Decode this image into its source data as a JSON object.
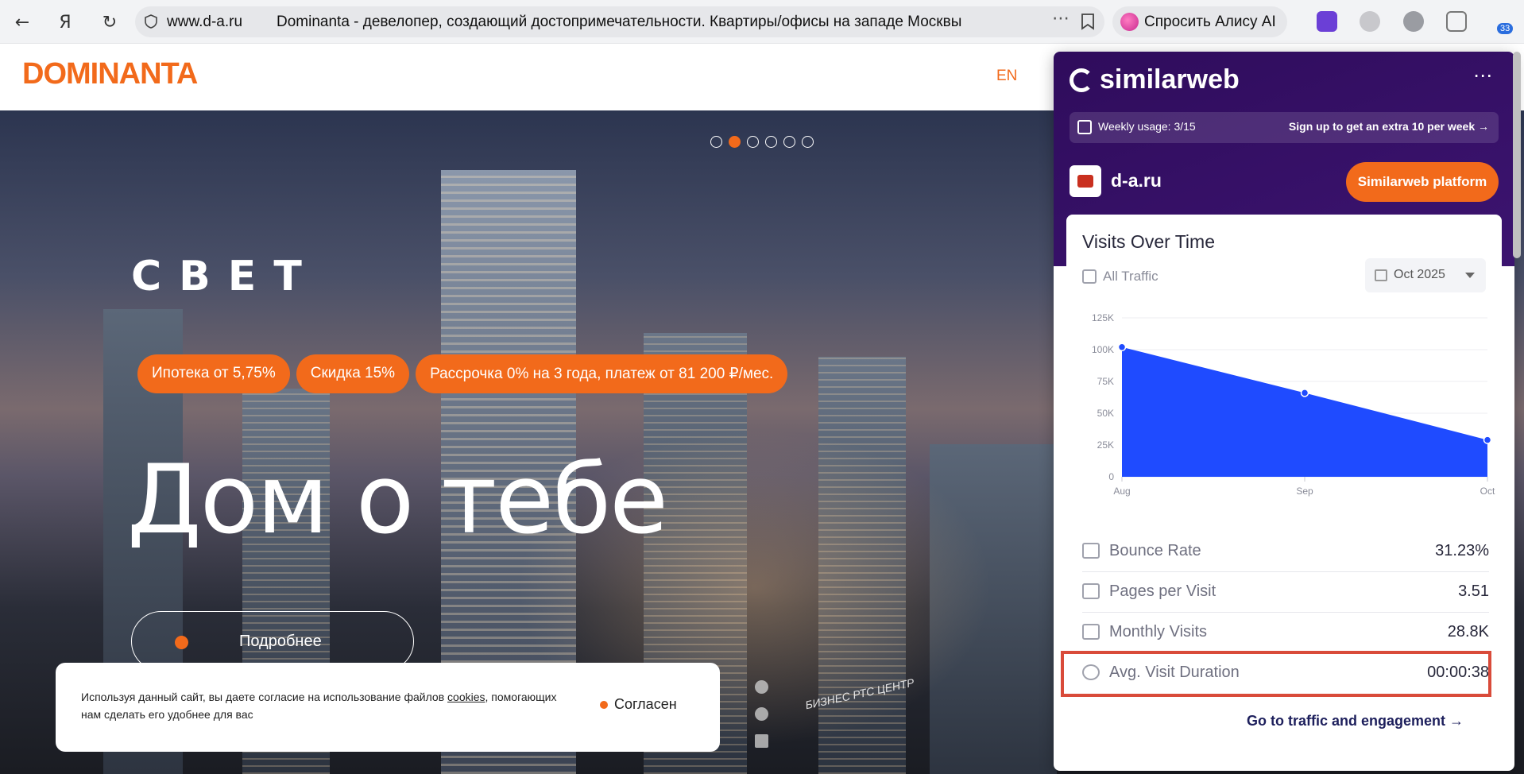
{
  "browser": {
    "url": "www.d-a.ru",
    "tab_title": "Dominanta - девелопер, создающий достопримечательности. Квартиры/офисы на западе Москвы",
    "alice_label": "Спросить Алису AI",
    "ext_badge": "33"
  },
  "site": {
    "logo": "DOMINANTA",
    "lang": "EN",
    "hero_kicker": "СВЕТ",
    "pills": [
      "Ипотека от 5,75%",
      "Скидка 15%",
      "Рассрочка 0% на 3 года, платеж от 81 200 ₽/мес."
    ],
    "headline": "Дом о тебе",
    "more_button": "Подробнее",
    "sign_text": "БИЗНЕС РТС ЦЕНТР",
    "cookie_text_1": "Используя данный сайт, вы даете согласие на использование файлов ",
    "cookie_link": "cookies",
    "cookie_text_2": ", помогающих нам сделать его удобнее для вас",
    "cookie_agree": "Согласен"
  },
  "similarweb": {
    "brand": "similarweb",
    "usage_text": "Weekly usage: 3/15",
    "usage_link": "Sign up to get an extra 10 per week →",
    "domain": "d-a.ru",
    "platform_button": "Similarweb platform",
    "card_title": "Visits Over Time",
    "traffic_label": "All Traffic",
    "date_label": "Oct 2025",
    "metrics": [
      {
        "label": "Bounce Rate",
        "value": "31.23%"
      },
      {
        "label": "Pages per Visit",
        "value": "3.51"
      },
      {
        "label": "Monthly Visits",
        "value": "28.8K"
      },
      {
        "label": "Avg. Visit Duration",
        "value": "00:00:38"
      }
    ],
    "go_link": "Go to traffic and engagement →",
    "accent": "#1f4bff"
  },
  "chart_data": {
    "type": "area",
    "categories": [
      "Aug",
      "Sep",
      "Oct"
    ],
    "values": [
      102000,
      66000,
      29000
    ],
    "yticks": [
      "0",
      "25K",
      "50K",
      "75K",
      "100K",
      "125K"
    ],
    "ylim": [
      0,
      125000
    ],
    "title": "",
    "xlabel": "",
    "ylabel": ""
  }
}
